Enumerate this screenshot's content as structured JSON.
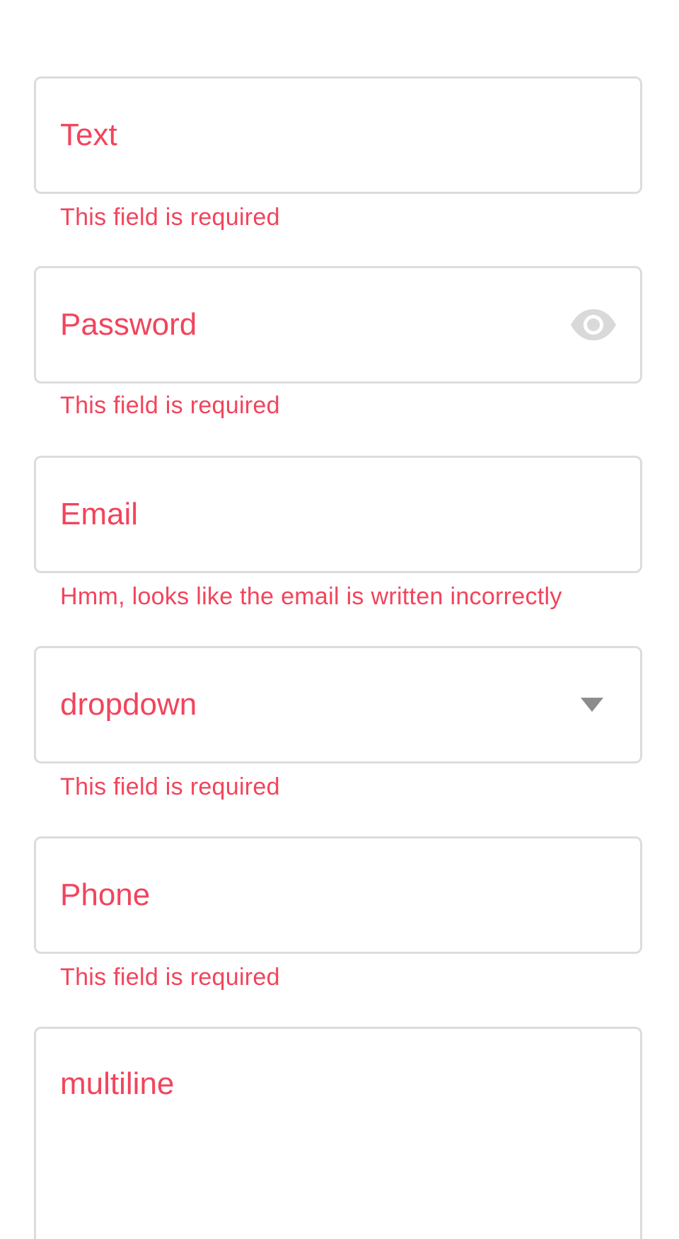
{
  "form": {
    "fields": [
      {
        "type": "text",
        "placeholder": "Text",
        "error": "This field is required"
      },
      {
        "type": "password",
        "placeholder": "Password",
        "error": "This field is required",
        "trailing_icon": "eye-icon"
      },
      {
        "type": "email",
        "placeholder": "Email",
        "error": "Hmm, looks like the email is written incorrectly"
      },
      {
        "type": "dropdown",
        "placeholder": "dropdown",
        "error": "This field is required",
        "trailing_icon": "chevron-down-icon"
      },
      {
        "type": "phone",
        "placeholder": "Phone",
        "error": "This field is required"
      },
      {
        "type": "multiline",
        "placeholder": "multiline"
      }
    ]
  },
  "colors": {
    "error_text": "#f2445c",
    "border": "#dcdcdc",
    "icon_light": "#d9d9d9",
    "icon_dark": "#8c8c8c",
    "background": "#ffffff"
  }
}
